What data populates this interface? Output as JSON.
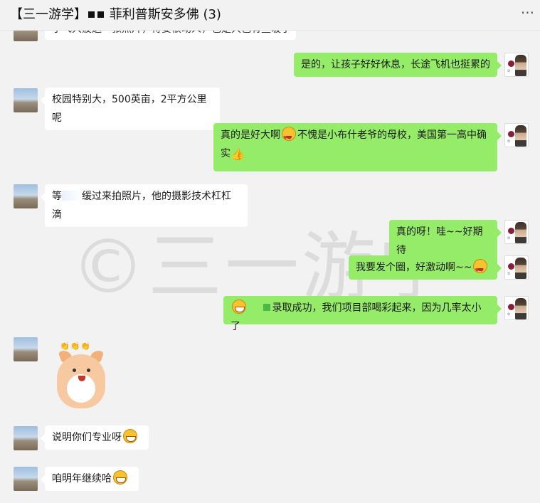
{
  "header": {
    "title_prefix": "【三一游学】",
    "title_name": "菲利普斯安多佛 (3)",
    "more": "···"
  },
  "watermark": "©三一游学",
  "messages": {
    "m0": "子飞大疲送一张照片，得要很动人，也是大色有些暖了",
    "m1": "是的，让孩子好好休息，长途飞机也挺累的",
    "m2": "校园特别大，500英亩，2平方公里呢",
    "m3a": "真的是好大啊",
    "m3b": "不愧是小布什老爷的母校，美国第一高中确",
    "m3c": "实",
    "m4a": "等",
    "m4b": "缓过来拍照片，他的摄影技术杠杠滴",
    "m5": "真的呀！哇~~好期待",
    "m6": "我要发个圈，好激动啊~~",
    "m7": "录取成功，我们项目部喝彩起来，因为几率太小了",
    "m8_sticker_text": "👏👏👏",
    "m9": "说明你们专业呀",
    "m10": "咱明年继续哈"
  },
  "icons": {
    "grin": "grinning-emoji-icon",
    "heart_eyes": "heart-eyes-emoji-icon",
    "thumbs_up": "thumbs-up-icon"
  },
  "colors": {
    "bubble_self": "#95ec69",
    "bubble_other": "#ffffff",
    "background": "#f2f2f2"
  }
}
